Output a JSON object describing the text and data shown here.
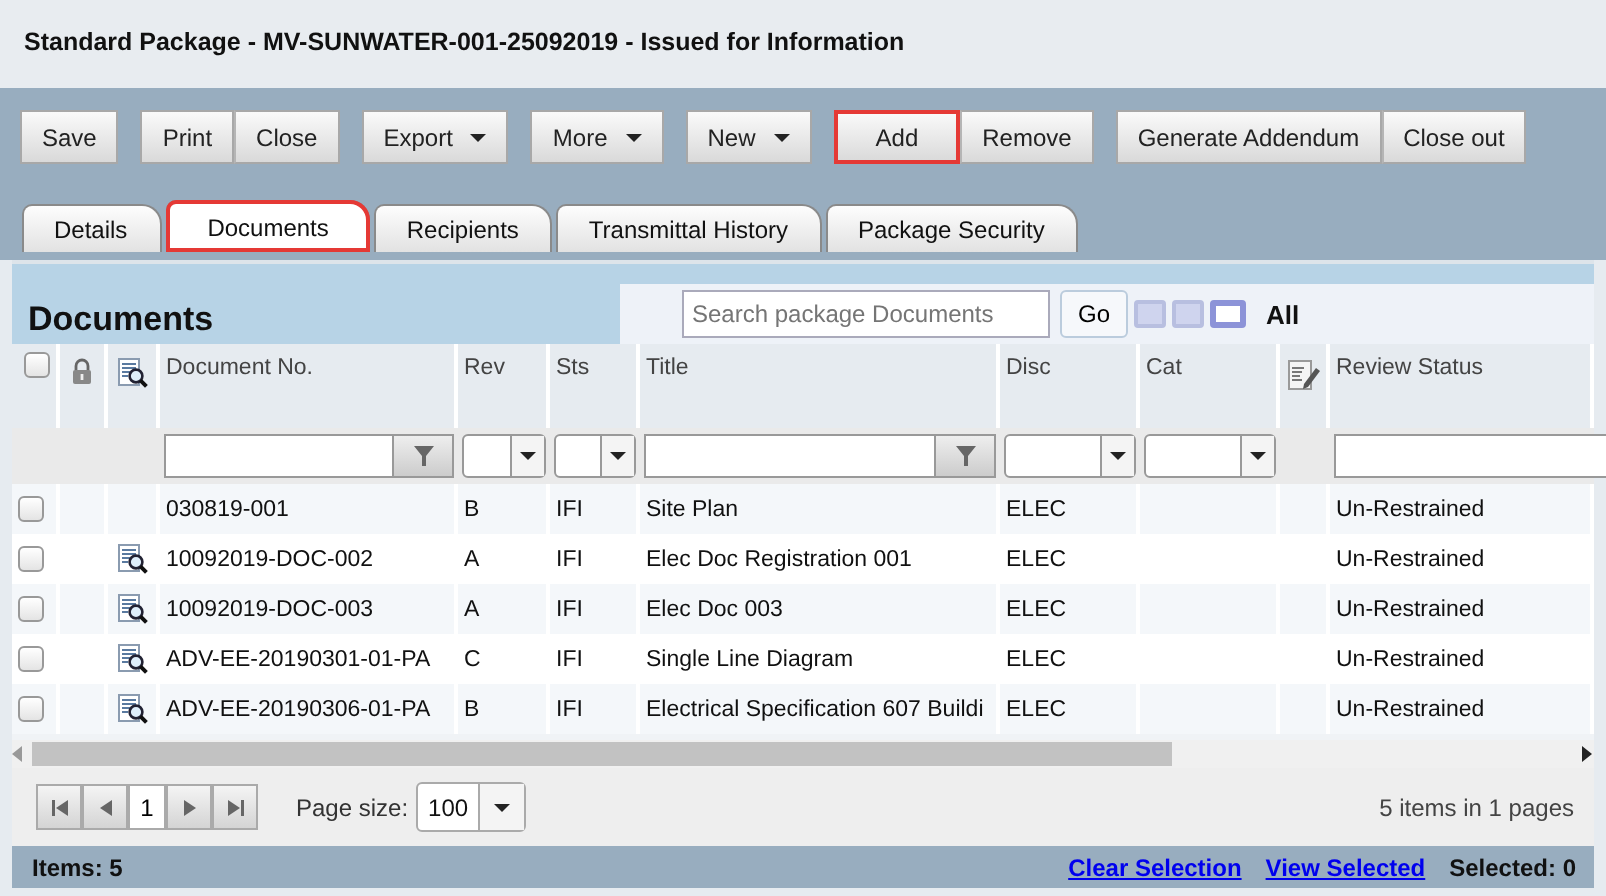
{
  "window": {
    "title": "Standard Package - MV-SUNWATER-001-25092019 - Issued for Information"
  },
  "toolbar": {
    "groups": [
      [
        {
          "label": "Save",
          "dropdown": false,
          "highlighted": false
        }
      ],
      [
        {
          "label": "Print",
          "dropdown": false,
          "highlighted": false
        },
        {
          "label": "Close",
          "dropdown": false,
          "highlighted": false
        }
      ],
      [
        {
          "label": "Export",
          "dropdown": true,
          "highlighted": false
        }
      ],
      [
        {
          "label": "More",
          "dropdown": true,
          "highlighted": false
        }
      ],
      [
        {
          "label": "New",
          "dropdown": true,
          "highlighted": false
        }
      ],
      [
        {
          "label": "Add",
          "dropdown": false,
          "highlighted": true
        },
        {
          "label": "Remove",
          "dropdown": false,
          "highlighted": false
        }
      ],
      [
        {
          "label": "Generate Addendum",
          "dropdown": false,
          "highlighted": false
        },
        {
          "label": "Close out",
          "dropdown": false,
          "highlighted": false
        }
      ]
    ]
  },
  "tabs": [
    {
      "label": "Details",
      "selected": false,
      "highlighted": false
    },
    {
      "label": "Documents",
      "selected": true,
      "highlighted": true
    },
    {
      "label": "Recipients",
      "selected": false,
      "highlighted": false
    },
    {
      "label": "Transmittal History",
      "selected": false,
      "highlighted": false
    },
    {
      "label": "Package Security",
      "selected": false,
      "highlighted": false
    }
  ],
  "documents": {
    "heading": "Documents",
    "search": {
      "placeholder": "Search package Documents",
      "button": "Go"
    },
    "view_modes": [
      {
        "selected": false
      },
      {
        "selected": false
      },
      {
        "selected": true
      }
    ],
    "view_label": "All",
    "select_all": {
      "checked": false
    },
    "columns": [
      {
        "kind": "checkbox"
      },
      {
        "kind": "lock"
      },
      {
        "kind": "preview"
      },
      {
        "kind": "text-button",
        "label": "Document No."
      },
      {
        "kind": "select",
        "label": "Rev"
      },
      {
        "kind": "select",
        "label": "Sts"
      },
      {
        "kind": "text-button",
        "label": "Title"
      },
      {
        "kind": "select",
        "label": "Disc"
      },
      {
        "kind": "select",
        "label": "Cat"
      },
      {
        "kind": "edit"
      },
      {
        "kind": "text",
        "label": "Review Status"
      }
    ],
    "rows": [
      {
        "checked": false,
        "preview": false,
        "doc_no": "030819-001",
        "rev": "B",
        "sts": "IFI",
        "title": "Site Plan",
        "disc": "ELEC",
        "review_status": "Un-Restrained"
      },
      {
        "checked": false,
        "preview": true,
        "doc_no": "10092019-DOC-002",
        "rev": "A",
        "sts": "IFI",
        "title": "Elec Doc Registration 001",
        "disc": "ELEC",
        "review_status": "Un-Restrained"
      },
      {
        "checked": false,
        "preview": true,
        "doc_no": "10092019-DOC-003",
        "rev": "A",
        "sts": "IFI",
        "title": "Elec Doc 003",
        "disc": "ELEC",
        "review_status": "Un-Restrained"
      },
      {
        "checked": false,
        "preview": true,
        "doc_no": "ADV-EE-20190301-01-PA",
        "rev": "C",
        "sts": "IFI",
        "title": "Single Line Diagram",
        "disc": "ELEC",
        "review_status": "Un-Restrained"
      },
      {
        "checked": false,
        "preview": true,
        "doc_no": "ADV-EE-20190306-01-PA",
        "rev": "B",
        "sts": "IFI",
        "title": "Electrical Specification 607 Buildi",
        "disc": "ELEC",
        "review_status": "Un-Restrained"
      }
    ],
    "pager": {
      "pages": [
        {
          "label": "1",
          "selected": true
        }
      ],
      "page_size_label": "Page size:",
      "page_size": "100",
      "summary": "5 items in 1 pages"
    }
  },
  "status_bar": {
    "items": "Items: 5",
    "links": [
      "Clear Selection",
      "View Selected"
    ],
    "selected": "Selected: 0"
  }
}
